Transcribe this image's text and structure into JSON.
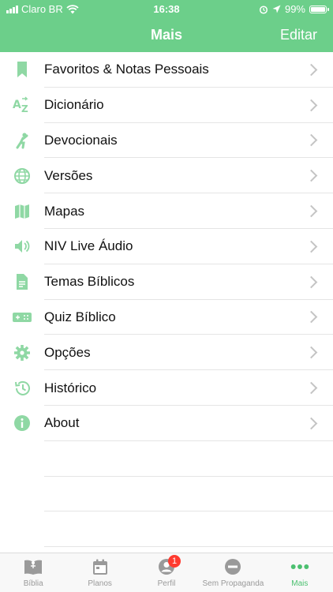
{
  "status": {
    "carrier": "Claro BR",
    "time": "16:38",
    "battery": "99%",
    "battery_level": 0.99
  },
  "navbar": {
    "title": "Mais",
    "edit_label": "Editar"
  },
  "menu": [
    {
      "label": "Favoritos & Notas Pessoais",
      "icon": "bookmark-icon"
    },
    {
      "label": "Dicionário",
      "icon": "dictionary-icon"
    },
    {
      "label": "Devocionais",
      "icon": "kneeling-person-icon"
    },
    {
      "label": "Versões",
      "icon": "globe-icon"
    },
    {
      "label": "Mapas",
      "icon": "map-icon"
    },
    {
      "label": "NIV Live Áudio",
      "icon": "speaker-icon"
    },
    {
      "label": "Temas Bíblicos",
      "icon": "document-icon"
    },
    {
      "label": "Quiz Bíblico",
      "icon": "quiz-icon"
    },
    {
      "label": "Opções",
      "icon": "gear-icon"
    },
    {
      "label": "Histórico",
      "icon": "history-icon"
    },
    {
      "label": "About",
      "icon": "info-icon"
    }
  ],
  "tabs": [
    {
      "label": "Bíblia",
      "icon": "bible-icon"
    },
    {
      "label": "Planos",
      "icon": "calendar-icon"
    },
    {
      "label": "Perfil",
      "icon": "profile-icon",
      "badge": "1"
    },
    {
      "label": "Sem Propaganda",
      "icon": "no-ads-icon"
    },
    {
      "label": "Mais",
      "icon": "more-icon"
    }
  ],
  "colors": {
    "accent": "#6ccf8a",
    "icon_green": "#8fd8a4",
    "active_tab": "#4cc070",
    "badge": "#ff3b30"
  }
}
